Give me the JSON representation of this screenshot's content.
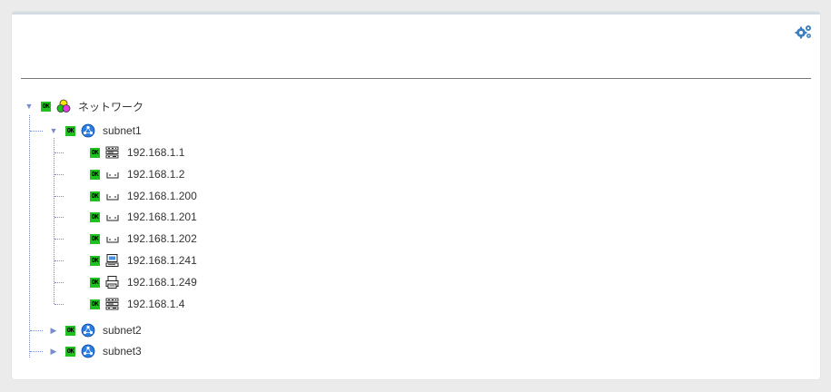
{
  "root": {
    "label": "ネットワーク",
    "status": "OK",
    "icon": "network-root-icon"
  },
  "subnets": [
    {
      "label": "subnet1",
      "status": "OK",
      "expanded": true,
      "icon": "subnet-icon",
      "hosts": [
        {
          "label": "192.168.1.1",
          "status": "OK",
          "icon": "switch-icon"
        },
        {
          "label": "192.168.1.2",
          "status": "OK",
          "icon": "device-icon"
        },
        {
          "label": "192.168.1.200",
          "status": "OK",
          "icon": "device-icon"
        },
        {
          "label": "192.168.1.201",
          "status": "OK",
          "icon": "device-icon"
        },
        {
          "label": "192.168.1.202",
          "status": "OK",
          "icon": "device-icon"
        },
        {
          "label": "192.168.1.241",
          "status": "OK",
          "icon": "computer-icon"
        },
        {
          "label": "192.168.1.249",
          "status": "OK",
          "icon": "printer-icon"
        },
        {
          "label": "192.168.1.4",
          "status": "OK",
          "icon": "switch-icon"
        }
      ]
    },
    {
      "label": "subnet2",
      "status": "OK",
      "expanded": false,
      "icon": "subnet-icon"
    },
    {
      "label": "subnet3",
      "status": "OK",
      "expanded": false,
      "icon": "subnet-icon"
    }
  ],
  "colors": {
    "ok": "#1fc01f",
    "connector": "#7b8ccc",
    "subnet": "#2a7de1"
  }
}
